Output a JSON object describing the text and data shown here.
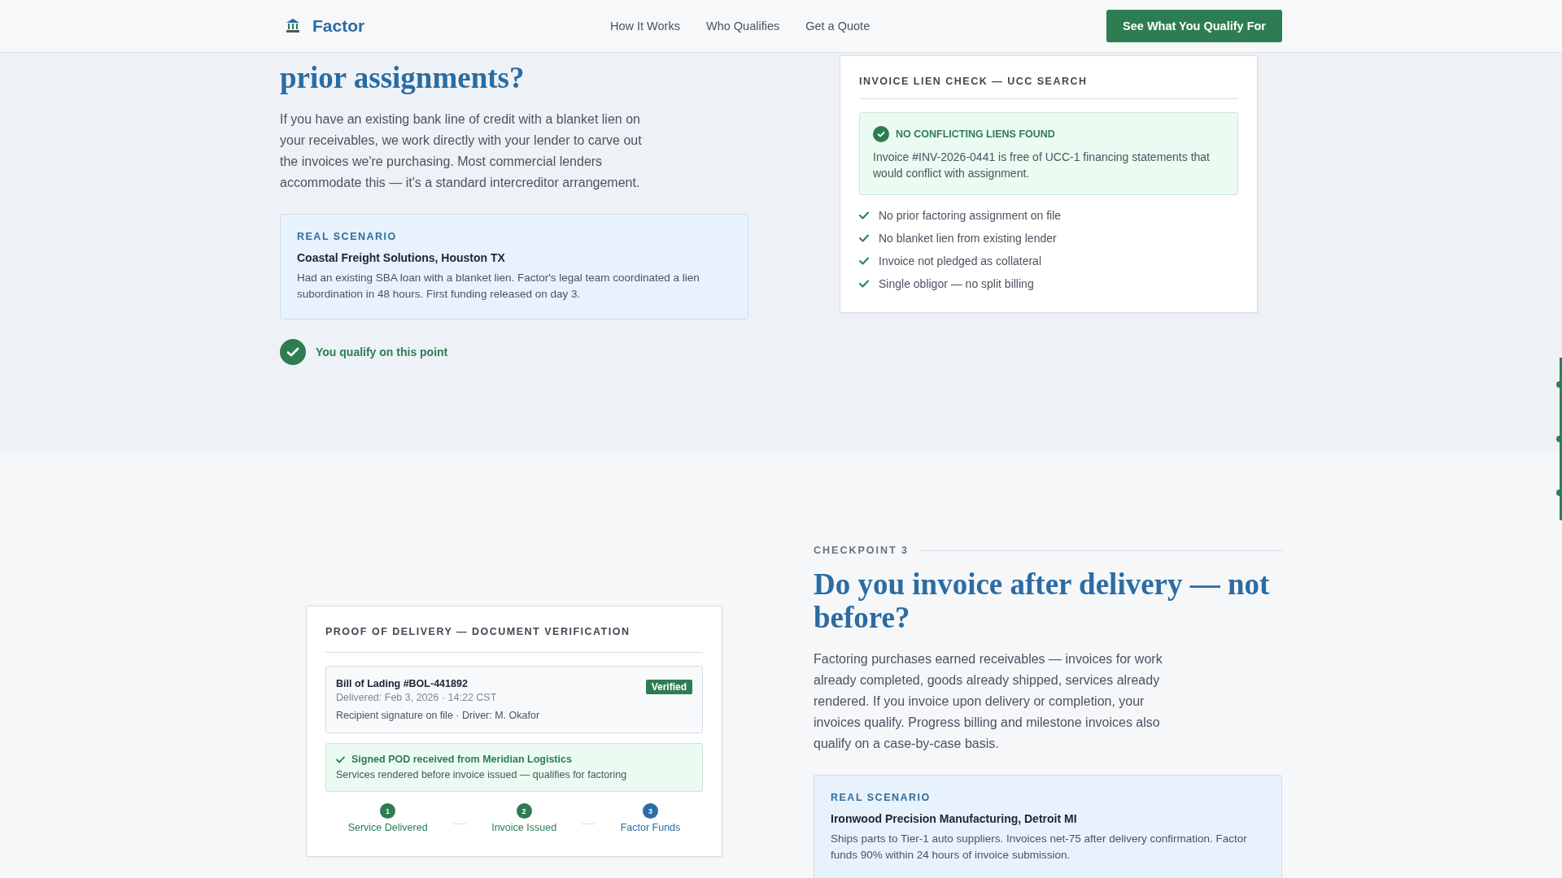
{
  "header": {
    "brand": "Factor",
    "nav": [
      {
        "label": "How It Works"
      },
      {
        "label": "Who Qualifies"
      },
      {
        "label": "Get a Quote"
      }
    ],
    "cta": "See What You Qualify For"
  },
  "section_liens": {
    "heading": "prior assignments?",
    "body": "If you have an existing bank line of credit with a blanket lien on your receivables, we work directly with your lender to carve out the invoices we're purchasing. Most commercial lenders accommodate this — it's a standard intercreditor arrangement.",
    "scenario": {
      "label": "REAL SCENARIO",
      "title": "Coastal Freight Solutions, Houston TX",
      "text": "Had an existing SBA loan with a blanket lien. Factor's legal team coordinated a lien subordination in 48 hours. First funding released on day 3."
    },
    "qualify": "You qualify on this point",
    "card": {
      "title": "INVOICE LIEN CHECK — UCC SEARCH",
      "result_title": "NO CONFLICTING LIENS FOUND",
      "result_text": "Invoice #INV-2026-0441 is free of UCC-1 financing statements that would conflict with assignment.",
      "checks": [
        "No prior factoring assignment on file",
        "No blanket lien from existing lender",
        "Invoice not pledged as collateral",
        "Single obligor — no split billing"
      ]
    }
  },
  "section_delivery": {
    "checkpoint": "CHECKPOINT 3",
    "heading": "Do you invoice after delivery — not before?",
    "body": "Factoring purchases earned receivables — invoices for work already completed, goods already shipped, services already rendered. If you invoice upon delivery or completion, your invoices qualify. Progress billing and milestone invoices also qualify on a case-by-case basis.",
    "scenario": {
      "label": "REAL SCENARIO",
      "title": "Ironwood Precision Manufacturing, Detroit MI",
      "text": "Ships parts to Tier-1 auto suppliers. Invoices net-75 after delivery confirmation. Factor funds 90% within 24 hours of invoice submission."
    },
    "card": {
      "title": "PROOF OF DELIVERY — DOCUMENT VERIFICATION",
      "document": {
        "title": "Bill of Lading #BOL-441892",
        "badge": "Verified",
        "meta": "Delivered: Feb 3, 2026 · 14:22 CST",
        "detail": "Recipient signature on file · Driver: M. Okafor"
      },
      "result_title": "Signed POD received from Meridian Logistics",
      "result_text": "Services rendered before invoice issued — qualifies for factoring",
      "steps": [
        {
          "number": "1",
          "label": "Service Delivered",
          "color": "#2e7d52"
        },
        {
          "number": "2",
          "label": "Invoice Issued",
          "color": "#2e7d52"
        },
        {
          "number": "3",
          "label": "Factor Funds",
          "color": "#2b6ca3"
        }
      ]
    }
  }
}
